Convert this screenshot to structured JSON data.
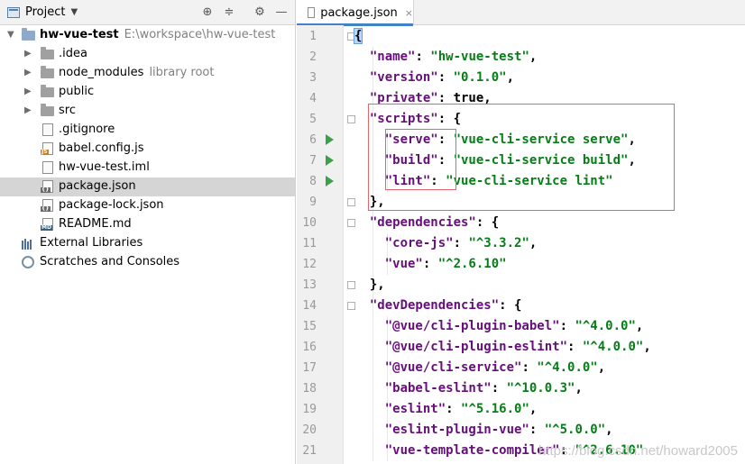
{
  "project": {
    "title": "Project",
    "tree": [
      {
        "label": "hw-vue-test",
        "hint": "E:\\workspace\\hw-vue-test",
        "icon": "folder-icon",
        "expanded": true
      },
      {
        "label": ".idea",
        "hint": "",
        "icon": "folder-icon"
      },
      {
        "label": "node_modules",
        "hint": "library root",
        "icon": "folder-icon"
      },
      {
        "label": "public",
        "hint": "",
        "icon": "folder-icon"
      },
      {
        "label": "src",
        "hint": "",
        "icon": "folder-icon"
      },
      {
        "label": ".gitignore",
        "hint": "",
        "icon": "file-icon"
      },
      {
        "label": "babel.config.js",
        "hint": "",
        "icon": "js-file-icon"
      },
      {
        "label": "hw-vue-test.iml",
        "hint": "",
        "icon": "iml-file-icon"
      },
      {
        "label": "package.json",
        "hint": "",
        "icon": "json-file-icon",
        "selected": true
      },
      {
        "label": "package-lock.json",
        "hint": "",
        "icon": "json-file-icon"
      },
      {
        "label": "README.md",
        "hint": "",
        "icon": "md-file-icon"
      },
      {
        "label": "External Libraries",
        "hint": "",
        "icon": "libraries-icon"
      },
      {
        "label": "Scratches and Consoles",
        "hint": "",
        "icon": "scratches-icon"
      }
    ]
  },
  "editor": {
    "tab": {
      "label": "package.json",
      "close": "×"
    },
    "line_numbers": [
      "1",
      "2",
      "3",
      "4",
      "5",
      "6",
      "7",
      "8",
      "9",
      "10",
      "11",
      "12",
      "13",
      "14",
      "15",
      "16",
      "17",
      "18",
      "19",
      "20",
      "21"
    ],
    "lines": [
      [
        {
          "t": "{",
          "c": "brace"
        }
      ],
      [
        {
          "t": "  \"name\"",
          "c": "k"
        },
        {
          "t": ": ",
          "c": "p"
        },
        {
          "t": "\"hw-vue-test\"",
          "c": "s"
        },
        {
          "t": ",",
          "c": "p"
        }
      ],
      [
        {
          "t": "  \"version\"",
          "c": "k"
        },
        {
          "t": ": ",
          "c": "p"
        },
        {
          "t": "\"0.1.0\"",
          "c": "s"
        },
        {
          "t": ",",
          "c": "p"
        }
      ],
      [
        {
          "t": "  \"private\"",
          "c": "k"
        },
        {
          "t": ": ",
          "c": "p"
        },
        {
          "t": "true",
          "c": "p"
        },
        {
          "t": ",",
          "c": "p"
        }
      ],
      [
        {
          "t": "  \"scripts\"",
          "c": "k"
        },
        {
          "t": ": {",
          "c": "p"
        }
      ],
      [
        {
          "t": "    \"serve\"",
          "c": "k"
        },
        {
          "t": ": ",
          "c": "p"
        },
        {
          "t": "\"vue-cli-service serve\"",
          "c": "s"
        },
        {
          "t": ",",
          "c": "p"
        }
      ],
      [
        {
          "t": "    \"build\"",
          "c": "k"
        },
        {
          "t": ": ",
          "c": "p"
        },
        {
          "t": "\"vue-cli-service build\"",
          "c": "s"
        },
        {
          "t": ",",
          "c": "p"
        }
      ],
      [
        {
          "t": "    \"lint\"",
          "c": "k"
        },
        {
          "t": ": ",
          "c": "p"
        },
        {
          "t": "\"vue-cli-service lint\"",
          "c": "s"
        }
      ],
      [
        {
          "t": "  },",
          "c": "p"
        }
      ],
      [
        {
          "t": "  \"dependencies\"",
          "c": "k"
        },
        {
          "t": ": {",
          "c": "p"
        }
      ],
      [
        {
          "t": "    \"core-js\"",
          "c": "k"
        },
        {
          "t": ": ",
          "c": "p"
        },
        {
          "t": "\"^3.3.2\"",
          "c": "s"
        },
        {
          "t": ",",
          "c": "p"
        }
      ],
      [
        {
          "t": "    \"vue\"",
          "c": "k"
        },
        {
          "t": ": ",
          "c": "p"
        },
        {
          "t": "\"^2.6.10\"",
          "c": "s"
        }
      ],
      [
        {
          "t": "  },",
          "c": "p"
        }
      ],
      [
        {
          "t": "  \"devDependencies\"",
          "c": "k"
        },
        {
          "t": ": {",
          "c": "p"
        }
      ],
      [
        {
          "t": "    \"@vue/cli-plugin-babel\"",
          "c": "k"
        },
        {
          "t": ": ",
          "c": "p"
        },
        {
          "t": "\"^4.0.0\"",
          "c": "s"
        },
        {
          "t": ",",
          "c": "p"
        }
      ],
      [
        {
          "t": "    \"@vue/cli-plugin-eslint\"",
          "c": "k"
        },
        {
          "t": ": ",
          "c": "p"
        },
        {
          "t": "\"^4.0.0\"",
          "c": "s"
        },
        {
          "t": ",",
          "c": "p"
        }
      ],
      [
        {
          "t": "    \"@vue/cli-service\"",
          "c": "k"
        },
        {
          "t": ": ",
          "c": "p"
        },
        {
          "t": "\"^4.0.0\"",
          "c": "s"
        },
        {
          "t": ",",
          "c": "p"
        }
      ],
      [
        {
          "t": "    \"babel-eslint\"",
          "c": "k"
        },
        {
          "t": ": ",
          "c": "p"
        },
        {
          "t": "\"^10.0.3\"",
          "c": "s"
        },
        {
          "t": ",",
          "c": "p"
        }
      ],
      [
        {
          "t": "    \"eslint\"",
          "c": "k"
        },
        {
          "t": ": ",
          "c": "p"
        },
        {
          "t": "\"^5.16.0\"",
          "c": "s"
        },
        {
          "t": ",",
          "c": "p"
        }
      ],
      [
        {
          "t": "    \"eslint-plugin-vue\"",
          "c": "k"
        },
        {
          "t": ": ",
          "c": "p"
        },
        {
          "t": "\"^5.0.0\"",
          "c": "s"
        },
        {
          "t": ",",
          "c": "p"
        }
      ],
      [
        {
          "t": "    \"vue-template-compiler\"",
          "c": "k"
        },
        {
          "t": ": ",
          "c": "p"
        },
        {
          "t": "\"^2.6.10\"",
          "c": "s"
        }
      ]
    ],
    "runnable_lines": [
      "6",
      "7",
      "8"
    ]
  },
  "watermark": "https://blog.csdn.net/howard2005",
  "colors": {
    "key": "#660e7a",
    "string": "#067d17",
    "selection": "#d5d5d5",
    "annotation_box": "#e8646c",
    "run_arrow": "#3aa04a"
  }
}
